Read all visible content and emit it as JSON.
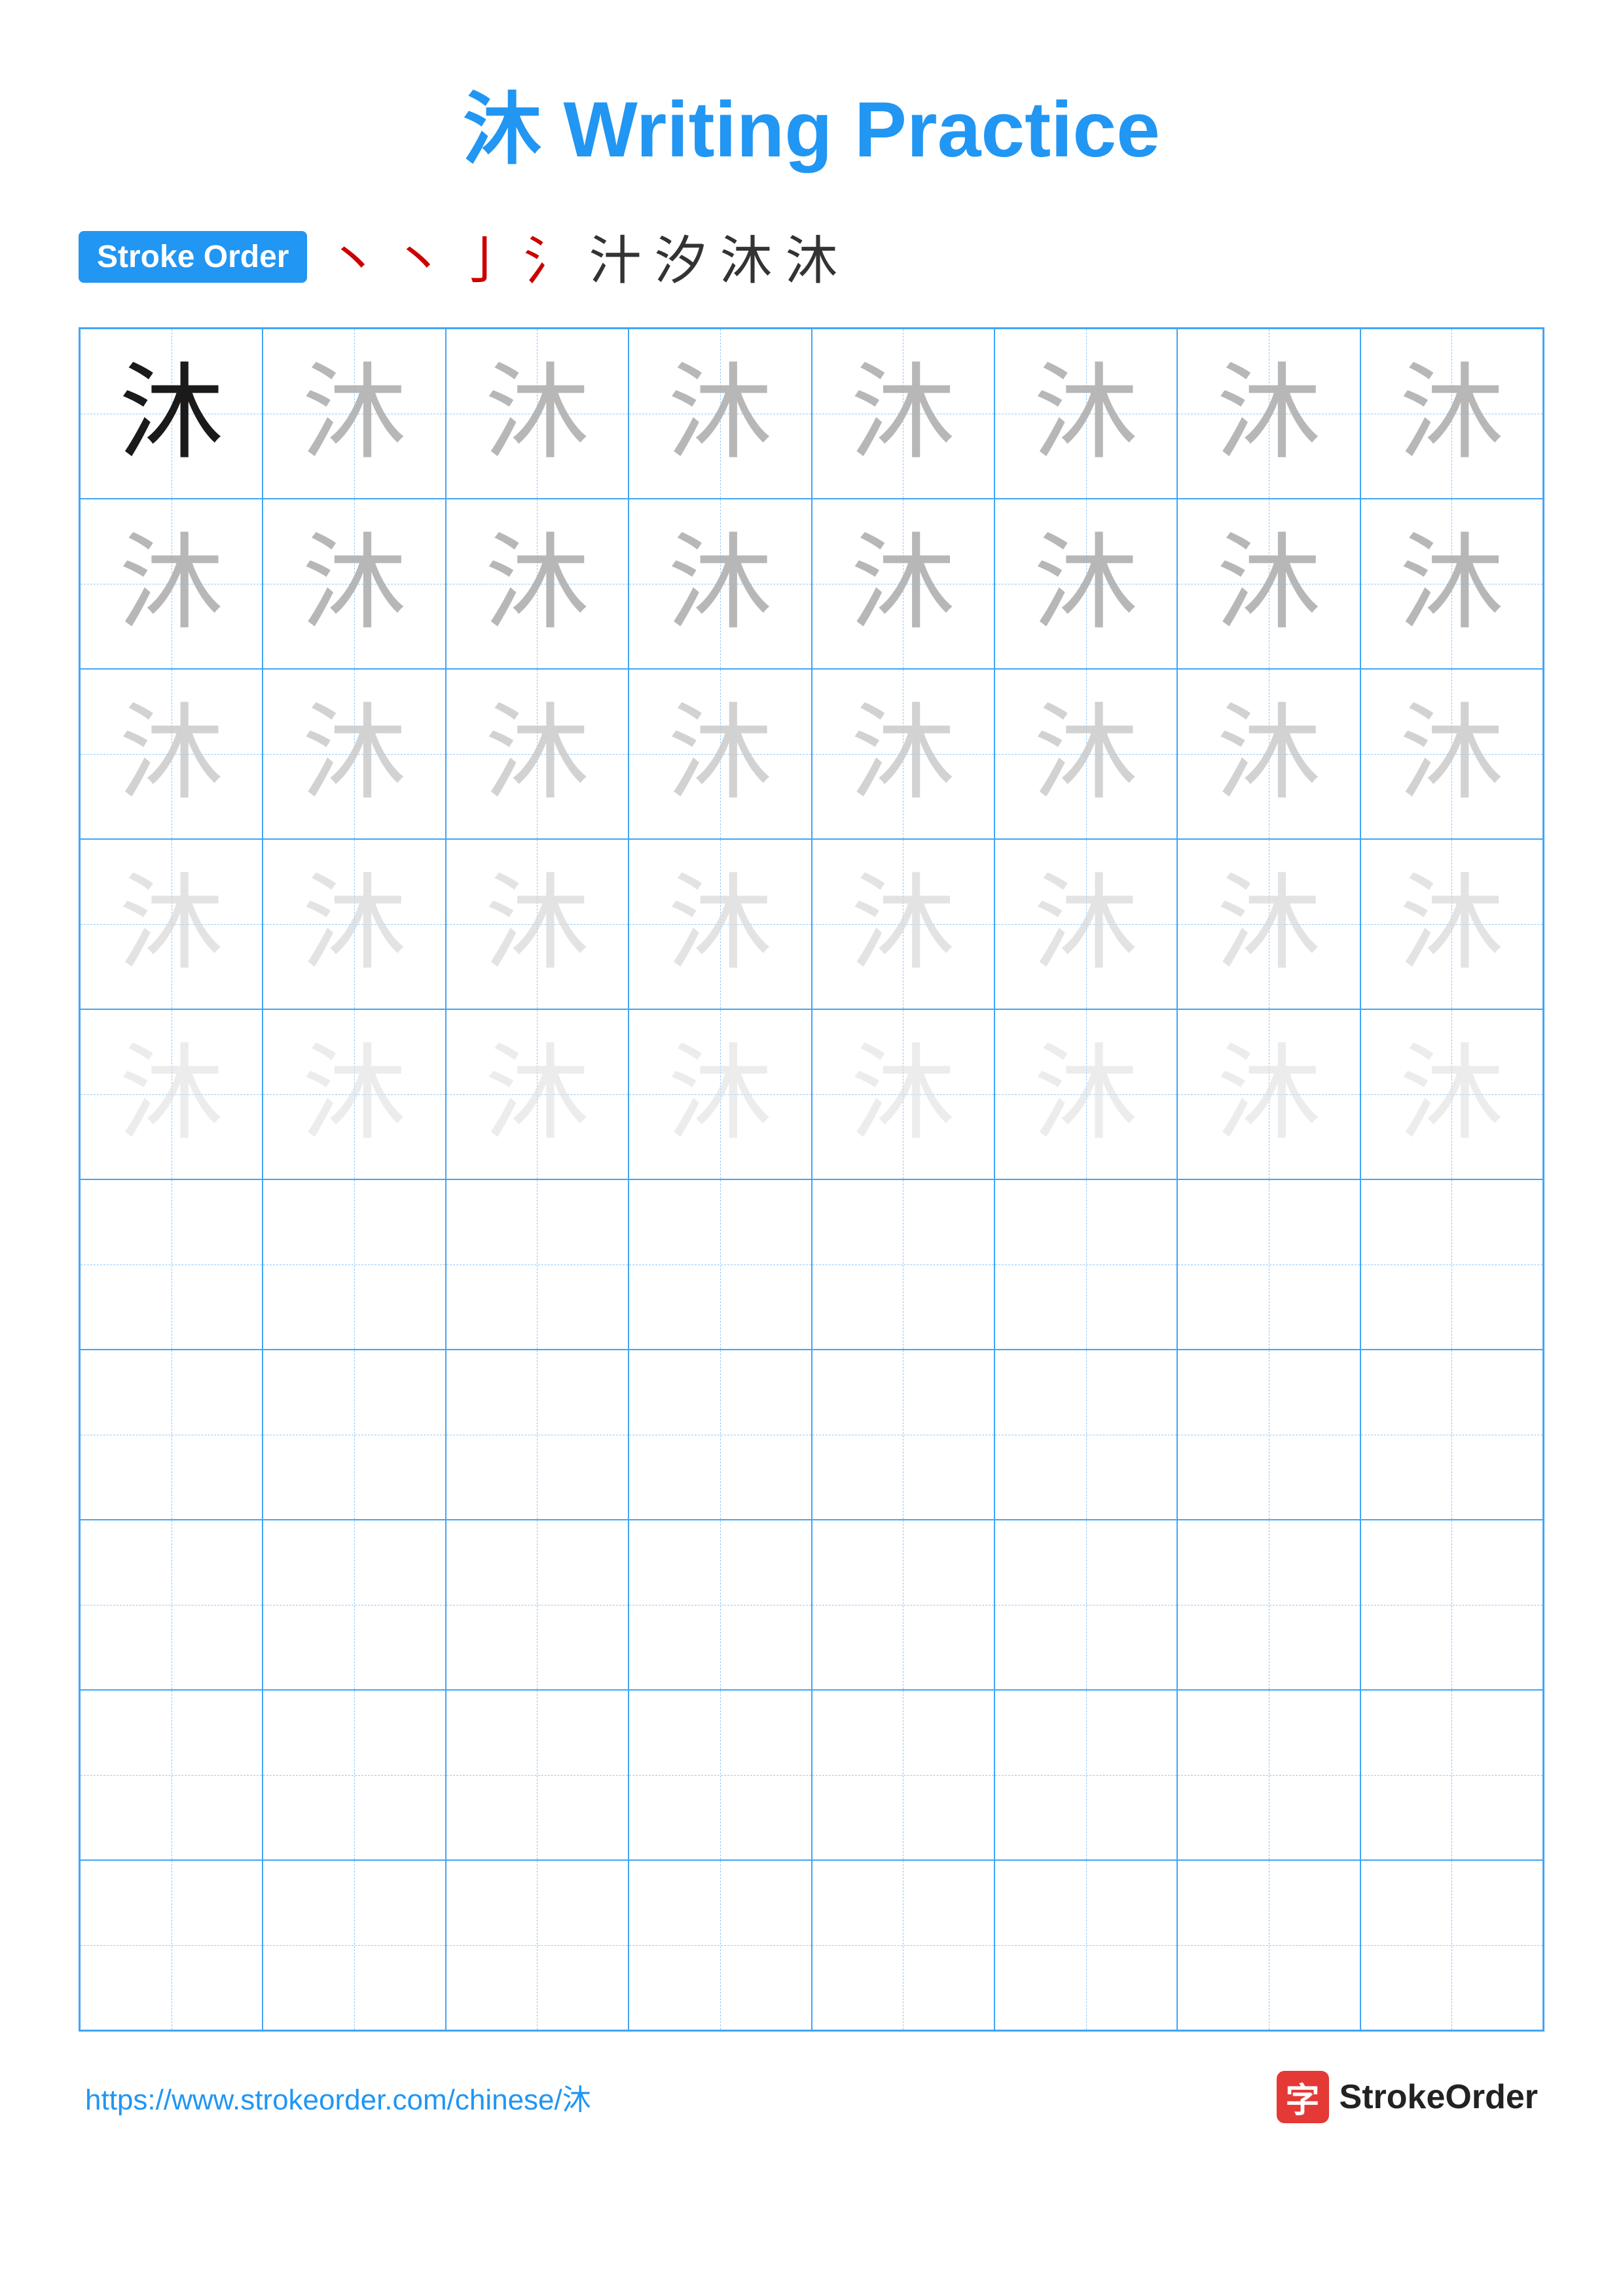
{
  "title": {
    "character": "沐",
    "text": "Writing Practice",
    "full": "沐 Writing Practice"
  },
  "stroke_order": {
    "badge_label": "Stroke Order",
    "characters": [
      "丶",
      "丶",
      "亅",
      "氵",
      "汁",
      "汐",
      "沐",
      "沐"
    ]
  },
  "grid": {
    "columns": 8,
    "rows": 10,
    "character": "沐",
    "practice_rows": 5,
    "empty_rows": 5
  },
  "footer": {
    "url": "https://www.strokeorder.com/chinese/沐",
    "logo_char": "字",
    "logo_text": "StrokeOrder"
  }
}
